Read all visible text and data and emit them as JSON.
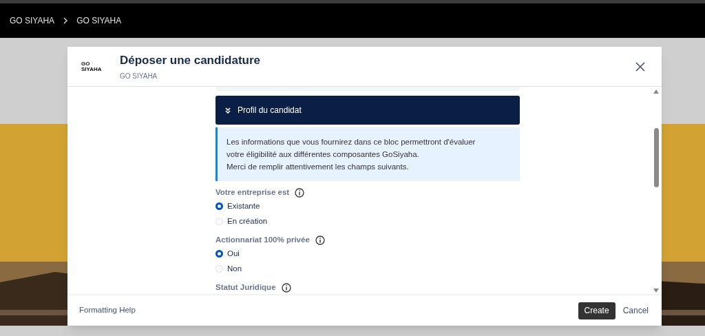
{
  "breadcrumb": [
    "GO SIYAHA",
    "GO SIYAHA"
  ],
  "dialog": {
    "logo": [
      "GO",
      "SIYAHA"
    ],
    "title": "Déposer une candidature",
    "subtitle": "GO SIYAHA",
    "section": {
      "title": "Profil du candidat",
      "expanded": true
    },
    "notice": [
      "Les informations que vous fournirez dans ce bloc permettront d'évaluer",
      "votre éligibilité aux différentes composantes GoSiyaha.",
      "Merci de remplir attentivement les champs suivants."
    ],
    "fields": [
      {
        "label": "Votre entreprise est",
        "options": [
          {
            "label": "Existante",
            "selected": true
          },
          {
            "label": "En création",
            "selected": false
          }
        ]
      },
      {
        "label": "Actionnariat 100% privée",
        "options": [
          {
            "label": "Oui",
            "selected": true
          },
          {
            "label": "Non",
            "selected": false
          }
        ]
      },
      {
        "label": "Statut Juridique"
      }
    ],
    "footer": {
      "help": "Formatting Help",
      "primary": "Create",
      "secondary": "Cancel"
    }
  }
}
